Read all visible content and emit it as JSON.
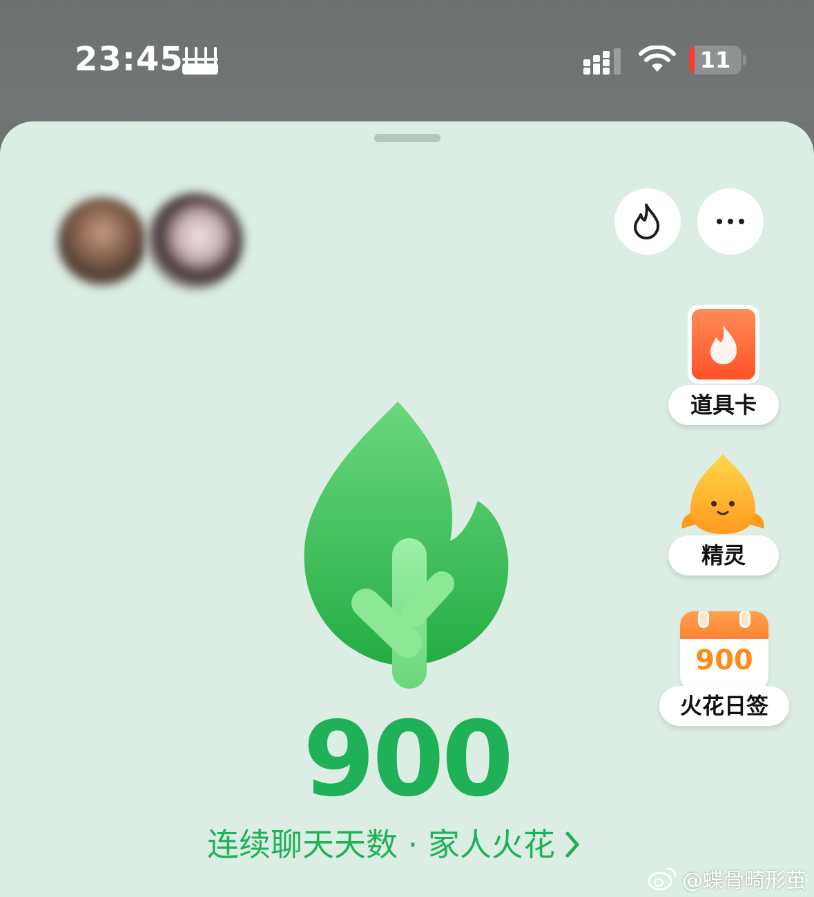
{
  "status_bar": {
    "time": "23:45",
    "battery": "11"
  },
  "header": {
    "fire_button_icon": "fire-outline-icon",
    "more_button_label": "···"
  },
  "side_menu": {
    "items": [
      {
        "label": "道具卡",
        "icon": "prop-card-icon"
      },
      {
        "label": "精灵",
        "icon": "sprite-icon"
      },
      {
        "label": "火花日签",
        "icon": "calendar-icon",
        "badge": "900"
      }
    ]
  },
  "main": {
    "count": "900",
    "subtitle": "连续聊天天数 · 家人火花",
    "leaf_icon": "green-sprout-flame-icon"
  },
  "watermark": {
    "text": "@蝶骨畸形茧"
  },
  "colors": {
    "accent": "#1fb157",
    "sheet_bg": "#dcede4",
    "status_bg": "#6f7473"
  }
}
